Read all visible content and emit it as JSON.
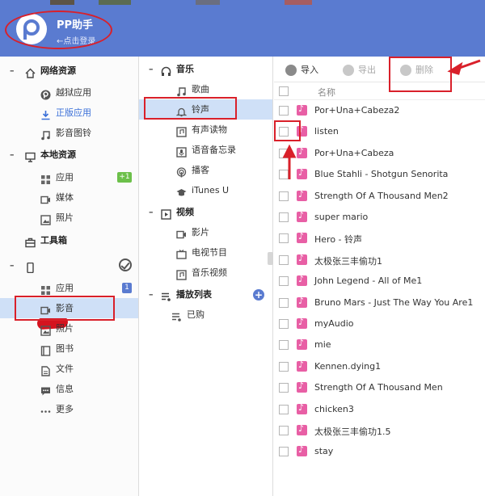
{
  "colors": {
    "header": "#5a7bd0",
    "annotation": "#d9202a",
    "selected": "#cfe0f7",
    "note": "#e85fa5",
    "badge_green": "#6cc04a"
  },
  "app": {
    "name": "PP助手",
    "login_hint": "←点击登录"
  },
  "sidebar": {
    "network": {
      "label": "网络资源",
      "icon": "home-icon",
      "items": [
        {
          "label": "越狱应用",
          "icon": "pp-logo-icon"
        },
        {
          "label": "正版应用",
          "icon": "download-icon"
        },
        {
          "label": "影音图铃",
          "icon": "music-note-icon"
        }
      ]
    },
    "local": {
      "label": "本地资源",
      "icon": "monitor-icon",
      "items": [
        {
          "label": "应用",
          "icon": "grid-icon",
          "badge": "+1"
        },
        {
          "label": "媒体",
          "icon": "video-icon"
        },
        {
          "label": "照片",
          "icon": "photo-icon"
        }
      ]
    },
    "toolbox": {
      "label": "工具箱",
      "icon": "toolbox-icon"
    },
    "device": {
      "label": "",
      "icon": "phone-icon",
      "items": [
        {
          "label": "应用",
          "icon": "grid-icon",
          "badge": "1"
        },
        {
          "label": "影音",
          "icon": "video-icon"
        },
        {
          "label": "照片",
          "icon": "photo-icon"
        },
        {
          "label": "图书",
          "icon": "book-icon"
        },
        {
          "label": "文件",
          "icon": "file-icon"
        },
        {
          "label": "信息",
          "icon": "message-icon"
        },
        {
          "label": "更多",
          "icon": "more-icon"
        }
      ]
    }
  },
  "media_tree": {
    "music": {
      "label": "音乐",
      "icon": "headphones-icon",
      "items": [
        {
          "label": "歌曲",
          "icon": "music-note-icon"
        },
        {
          "label": "铃声",
          "icon": "bell-icon"
        },
        {
          "label": "有声读物",
          "icon": "audiobook-icon"
        },
        {
          "label": "语音备忘录",
          "icon": "memo-icon"
        },
        {
          "label": "播客",
          "icon": "podcast-icon"
        },
        {
          "label": "iTunes U",
          "icon": "graduation-cap-icon"
        }
      ]
    },
    "video": {
      "label": "视频",
      "icon": "video-icon",
      "items": [
        {
          "label": "影片",
          "icon": "video-icon"
        },
        {
          "label": "电视节目",
          "icon": "tv-icon"
        },
        {
          "label": "音乐视频",
          "icon": "music-video-icon"
        }
      ]
    },
    "playlist": {
      "label": "播放列表",
      "icon": "playlist-icon",
      "items": [
        {
          "label": "已购",
          "icon": "playlist-icon"
        }
      ]
    }
  },
  "toolbar": {
    "import": "导入",
    "export": "导出",
    "delete": "删除"
  },
  "list": {
    "column_name": "名称",
    "rows": [
      "Por+Una+Cabeza2",
      "listen",
      "Por+Una+Cabeza",
      "Blue Stahli - Shotgun Senorita",
      "Strength Of A Thousand Men2",
      "super mario",
      "Hero - 铃声",
      "太极张三丰偷功1",
      "John Legend - All of Me1",
      "Bruno Mars - Just The Way You Are1",
      "myAudio",
      "mie",
      "Kennen.dying1",
      "Strength Of A Thousand Men",
      "chicken3",
      "太极张三丰偷功1.5",
      "stay"
    ]
  }
}
